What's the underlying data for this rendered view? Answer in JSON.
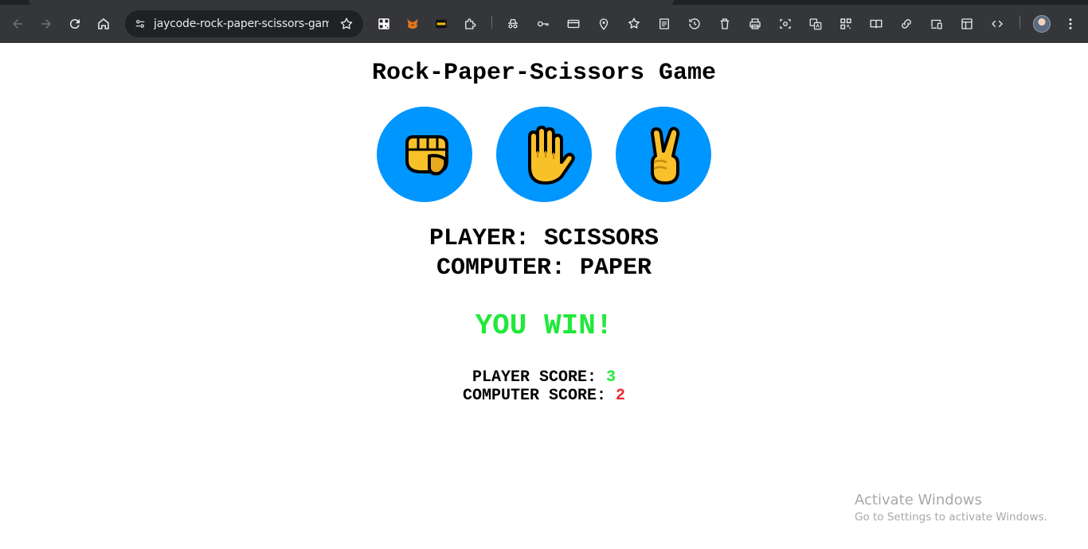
{
  "browser": {
    "url": "jaycode-rock-paper-scissors-gam...",
    "toolbar_icons": [
      "back-icon",
      "forward-icon",
      "reload-icon",
      "home-icon",
      "site-info-icon",
      "bookmark-star-icon",
      "qr-extension-icon",
      "metamask-fox-icon",
      "extension-box-icon",
      "puzzle-extensions-icon",
      "incognito-spy-icon",
      "key-icon",
      "card-icon",
      "location-pin-icon",
      "star-list-icon",
      "reading-list-icon",
      "history-icon",
      "trash-icon",
      "print-icon",
      "screenshot-icon",
      "translate-icon",
      "qr-code-icon",
      "reader-mode-icon",
      "link-icon",
      "cast-devices-icon",
      "layout-icon",
      "code-icon",
      "profile-avatar",
      "kebab-menu-icon"
    ]
  },
  "game": {
    "title": "Rock-Paper-Scissors Game",
    "choices": [
      {
        "name": "rock",
        "icon": "fist-icon"
      },
      {
        "name": "paper",
        "icon": "raised-hand-icon"
      },
      {
        "name": "scissors",
        "icon": "victory-hand-icon"
      }
    ],
    "player_result": "PLAYER: SCISSORS",
    "computer_result": "COMPUTER: PAPER",
    "verdict": "YOU WIN!",
    "player_score_label": "PLAYER SCORE: ",
    "player_score": "3",
    "computer_score_label": "COMPUTER SCORE: ",
    "computer_score": "2"
  },
  "colors": {
    "button_bg": "#0096ff",
    "win": "#22e83c",
    "lose": "#ee2b2b",
    "emoji_yellow": "#f8c12a"
  },
  "watermark": {
    "line1": "Activate Windows",
    "line2": "Go to Settings to activate Windows."
  }
}
